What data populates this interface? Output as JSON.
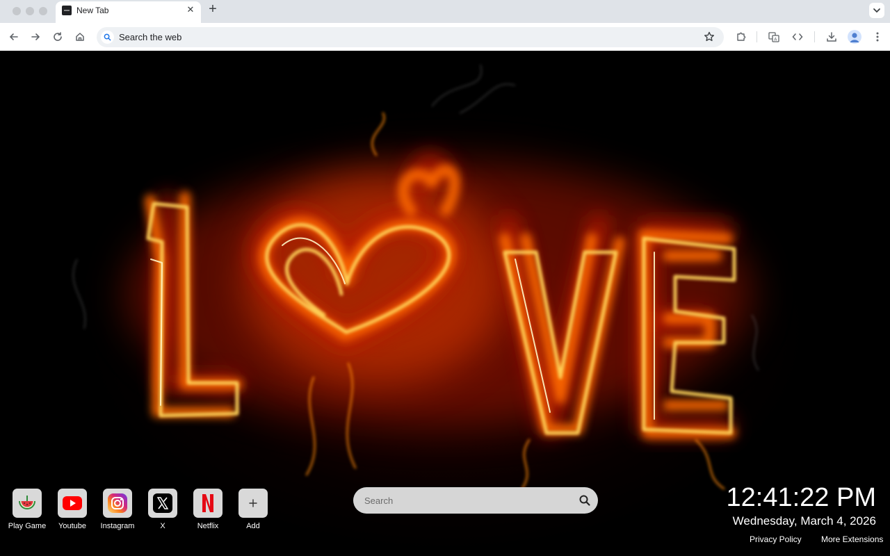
{
  "browser": {
    "tab": {
      "title": "New Tab"
    },
    "omnibox": {
      "text": "Search the web"
    }
  },
  "icons": {
    "back": "arrow-left-icon",
    "forward": "arrow-right-icon",
    "reload": "reload-icon",
    "home": "home-icon",
    "search": "search-icon",
    "bookmark": "star-icon",
    "extensions": "puzzle-icon",
    "translate": "translate-icon",
    "devtools": "code-icon",
    "downloads": "download-icon",
    "profile": "profile-icon",
    "menu": "kebab-menu-icon"
  },
  "shortcuts": [
    {
      "label": "Play Game",
      "icon": "watermelon-icon"
    },
    {
      "label": "Youtube",
      "icon": "youtube-icon"
    },
    {
      "label": "Instagram",
      "icon": "instagram-icon"
    },
    {
      "label": "X",
      "icon": "x-logo-icon"
    },
    {
      "label": "Netflix",
      "icon": "netflix-icon"
    },
    {
      "label": "Add",
      "icon": "plus-icon"
    }
  ],
  "search": {
    "placeholder": "Search"
  },
  "clock": {
    "time": "12:41:22 PM",
    "date": "Wednesday, March 4, 2026"
  },
  "footer": {
    "privacy_policy": "Privacy Policy",
    "more_extensions": "More Extensions"
  },
  "colors": {
    "fire_core": "#fff2a0",
    "fire_mid": "#ffab1e",
    "fire_outer": "#e62a00"
  }
}
